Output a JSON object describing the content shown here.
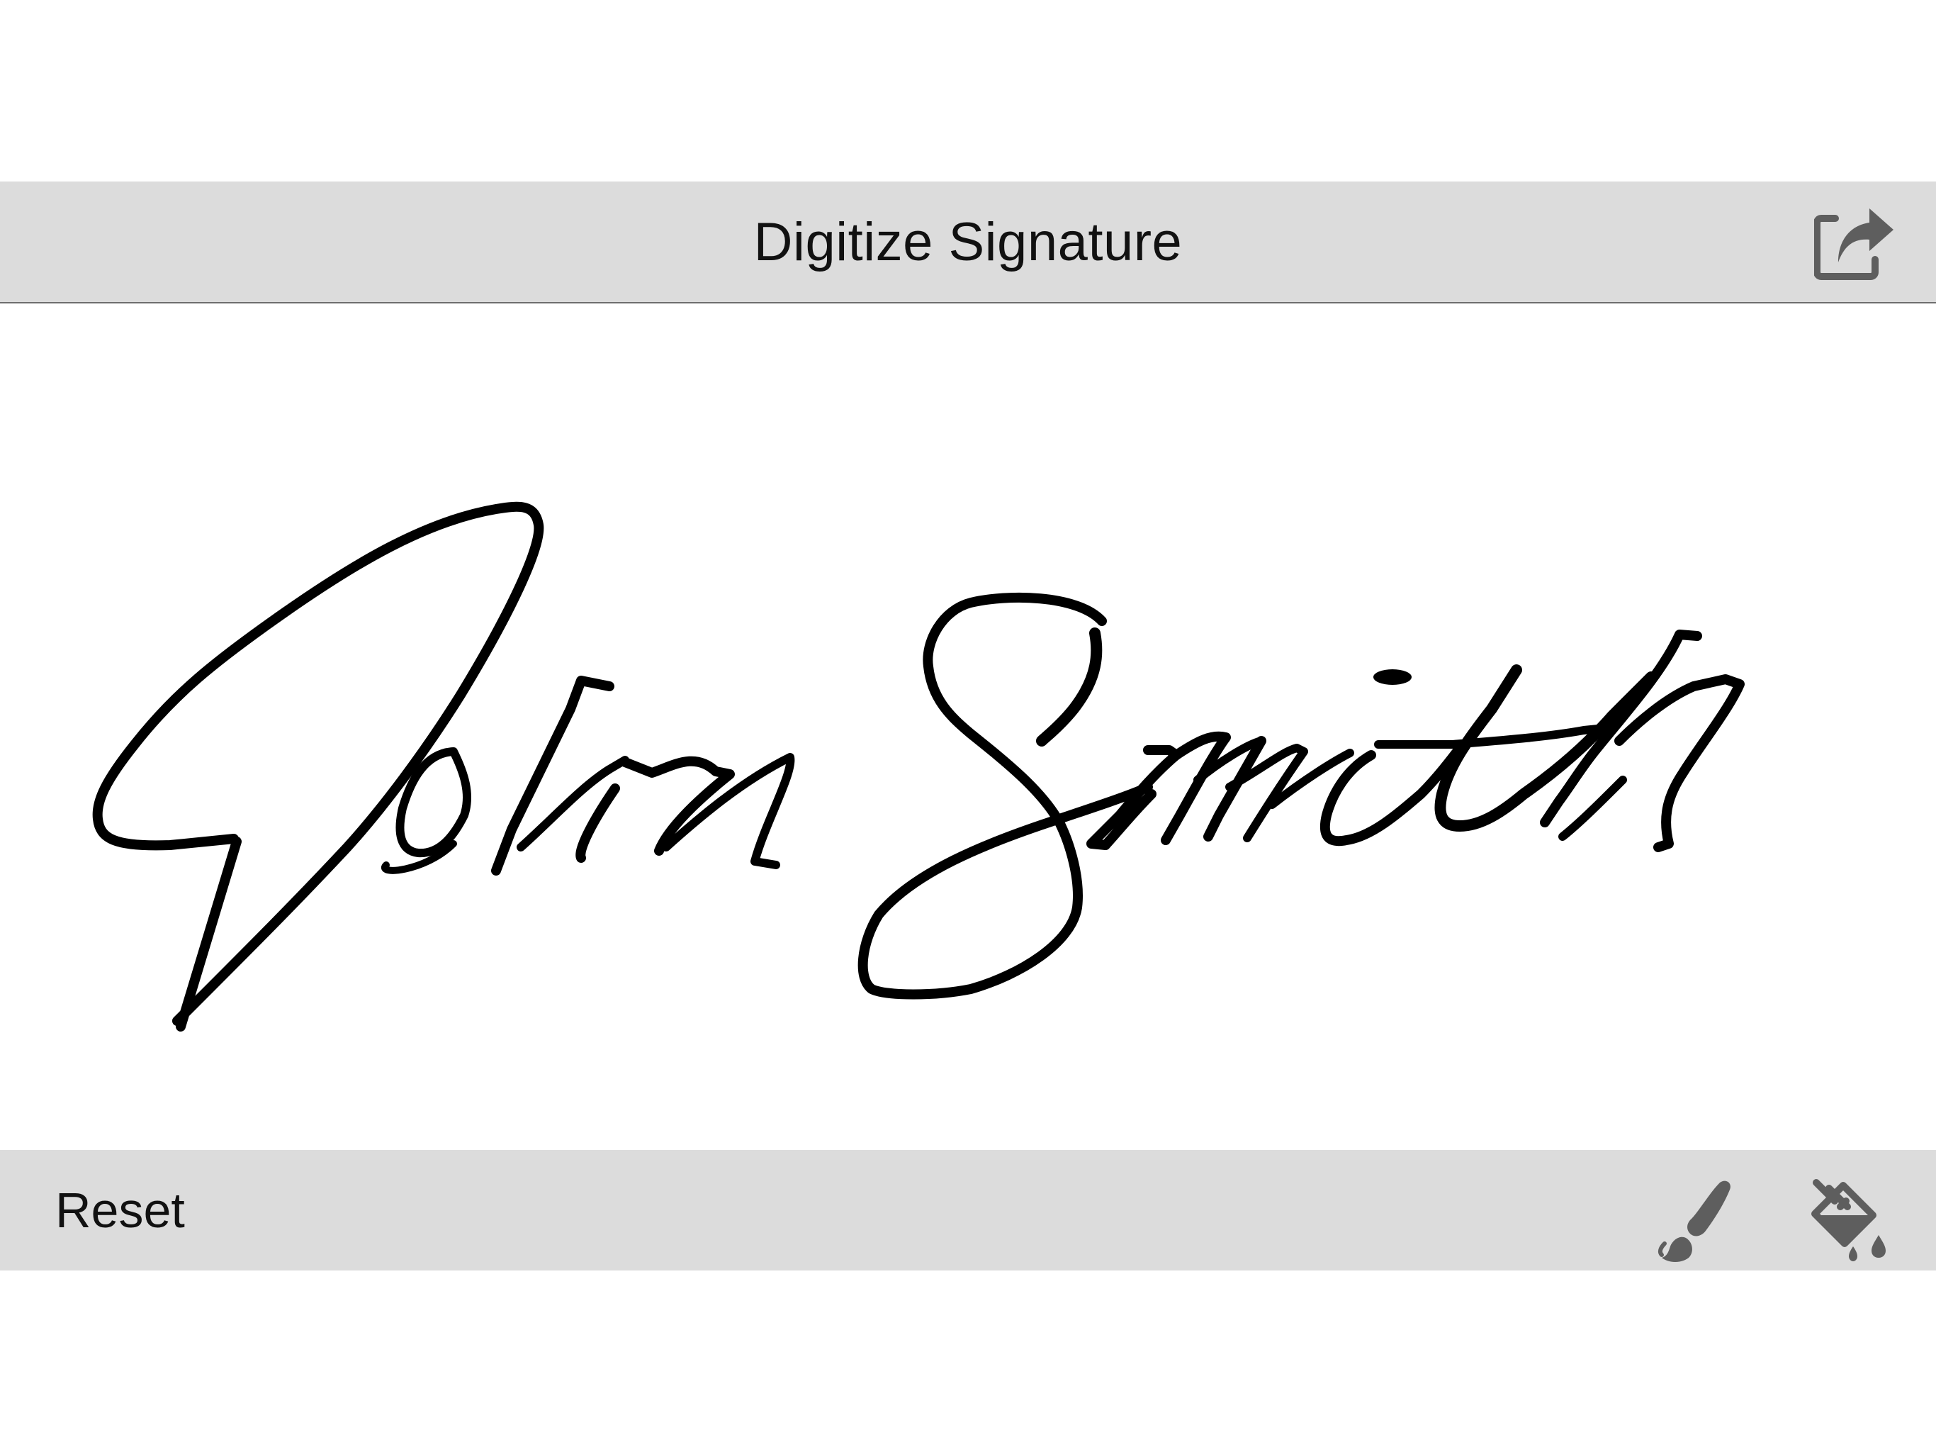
{
  "header": {
    "title": "Digitize Signature",
    "share_icon": "share-export-icon"
  },
  "canvas": {
    "signature_text": "John Smith",
    "ink_color": "#000000",
    "background_color": "#ffffff"
  },
  "footer": {
    "reset_label": "Reset",
    "brush_icon": "paint-brush-icon",
    "bucket_icon": "paint-bucket-icon"
  },
  "colors": {
    "toolbar_background": "#dcdcdc",
    "icon_gray": "#5e5e5e"
  }
}
